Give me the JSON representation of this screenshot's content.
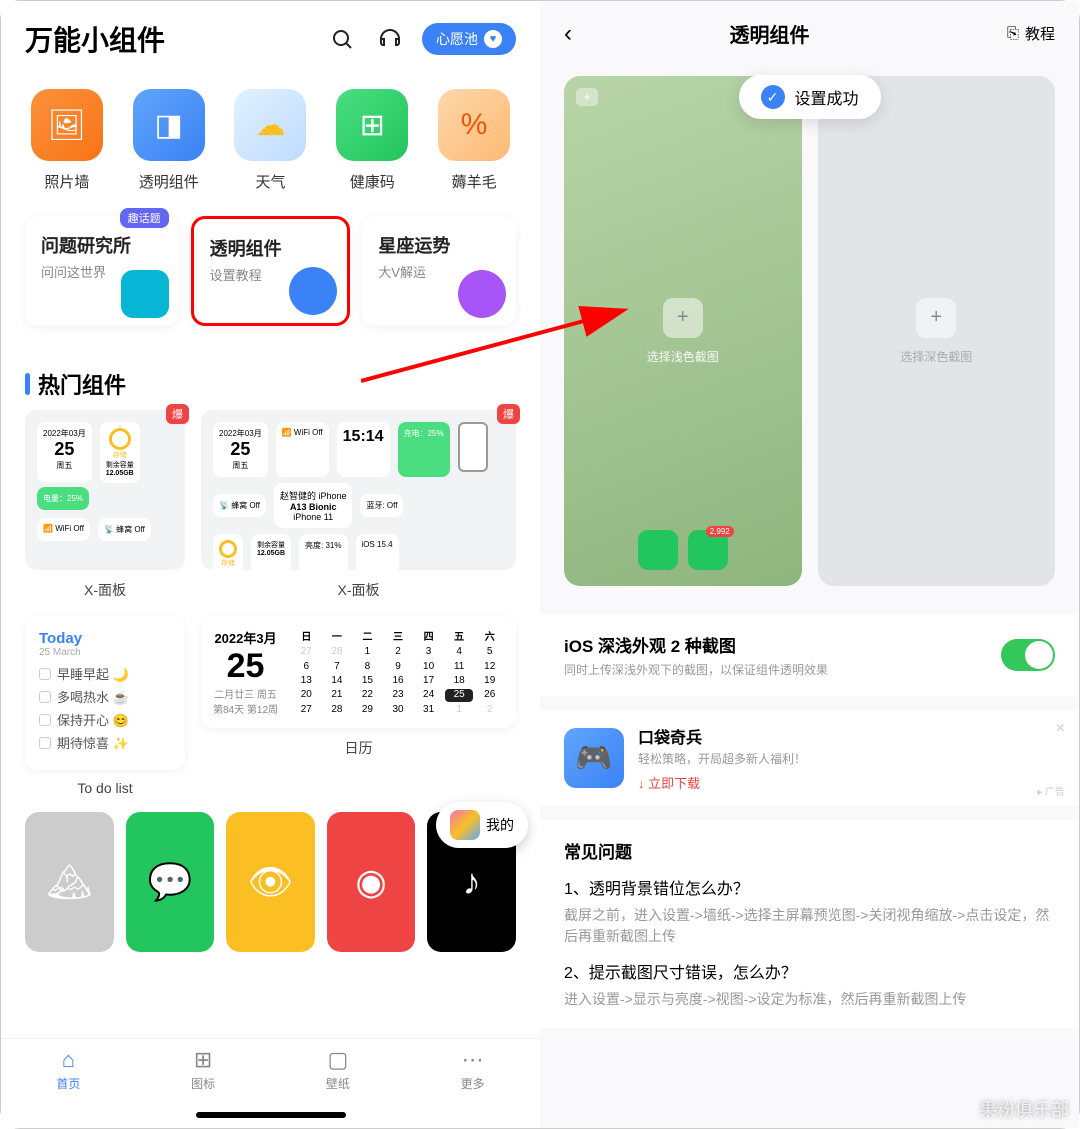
{
  "left": {
    "title": "万能小组件",
    "wish": "心愿池",
    "apps": [
      {
        "label": "照片墙",
        "color": "linear-gradient(135deg,#fb923c,#f97316)"
      },
      {
        "label": "透明组件",
        "color": "linear-gradient(135deg,#60a5fa,#3b82f6)"
      },
      {
        "label": "天气",
        "color": "linear-gradient(135deg,#e0f2fe,#bfdbfe)"
      },
      {
        "label": "健康码",
        "color": "linear-gradient(135deg,#4ade80,#22c55e)"
      },
      {
        "label": "薅羊毛",
        "color": "linear-gradient(135deg,#fed7aa,#fdba74)"
      }
    ],
    "cards": [
      {
        "title": "问题研究所",
        "sub": "问问这世界",
        "badge": "趣话题",
        "iconColor": "#06b6d4"
      },
      {
        "title": "透明组件",
        "sub": "设置教程",
        "iconColor": "#3b82f6"
      },
      {
        "title": "星座运势",
        "sub": "大V解运",
        "iconColor": "#a855f7"
      }
    ],
    "hotTitle": "热门组件",
    "panel1": {
      "label": "X-面板",
      "dateMonth": "2022年03月",
      "dateDay": "25",
      "dateWeek": "周五",
      "storage": "剩余容量",
      "storageVal": "12.05GB",
      "battery": "电量：25%",
      "wifi": "WiFi Off",
      "cell": "蜂窝 Off",
      "storeTag": "存储"
    },
    "panel2": {
      "label": "X-面板",
      "time": "15:14",
      "device": "赵智健的 iPhone",
      "chip": "A13 Bionic",
      "model": "iPhone 11",
      "dateMonth": "2022年03月",
      "dateDay": "25",
      "dateWeek": "周五",
      "batt": "充电：25%",
      "bt": "蓝牙: Off",
      "bright": "亮度: 31%",
      "ios": "iOS 15.4",
      "wifi": "WiFi Off",
      "cell": "蜂窝 Off",
      "storage": "剩余容量",
      "storageVal": "12.05GB",
      "storeTag": "存储"
    },
    "todo": {
      "title": "Today",
      "date": "25 March",
      "items": [
        "早睡早起 🌙",
        "多喝热水 ☕",
        "保持开心 😊",
        "期待惊喜 ✨"
      ],
      "label": "To do list"
    },
    "cal": {
      "month": "2022年3月",
      "day": "25",
      "lunar1": "二月廿三 周五",
      "lunar2": "第84天 第12周",
      "label": "日历",
      "wk": [
        "日",
        "一",
        "二",
        "三",
        "四",
        "五",
        "六"
      ]
    },
    "my": "我的",
    "tabs": [
      {
        "label": "首页",
        "icon": "⌂"
      },
      {
        "label": "图标",
        "icon": "⊞"
      },
      {
        "label": "壁纸",
        "icon": "▢"
      },
      {
        "label": "更多",
        "icon": "⋯"
      }
    ],
    "hot": "爆"
  },
  "right": {
    "title": "透明组件",
    "tutBtn": "教程",
    "toast": "设置成功",
    "lightLabel": "选择浅色截图",
    "darkLabel": "选择深色截图",
    "dockBadge": "2,992",
    "setting": {
      "title": "iOS 深浅外观 2 种截图",
      "sub": "同时上传深浅外观下的截图，以保证组件透明效果"
    },
    "ad": {
      "title": "口袋奇兵",
      "sub": "轻松策略，开局超多新人福利！",
      "dl": "↓ 立即下载",
      "tag": "▸ 广告"
    },
    "faq": {
      "title": "常见问题",
      "q1": "1、透明背景错位怎么办？",
      "a1": "截屏之前，进入设置->墙纸->选择主屏幕预览图->关闭视角缩放->点击设定，然后再重新截图上传",
      "q2": "2、提示截图尺寸错误，怎么办？",
      "a2": "进入设置->显示与亮度->视图->设定为标准，然后再重新截图上传"
    }
  },
  "watermark": "果粉俱乐部"
}
